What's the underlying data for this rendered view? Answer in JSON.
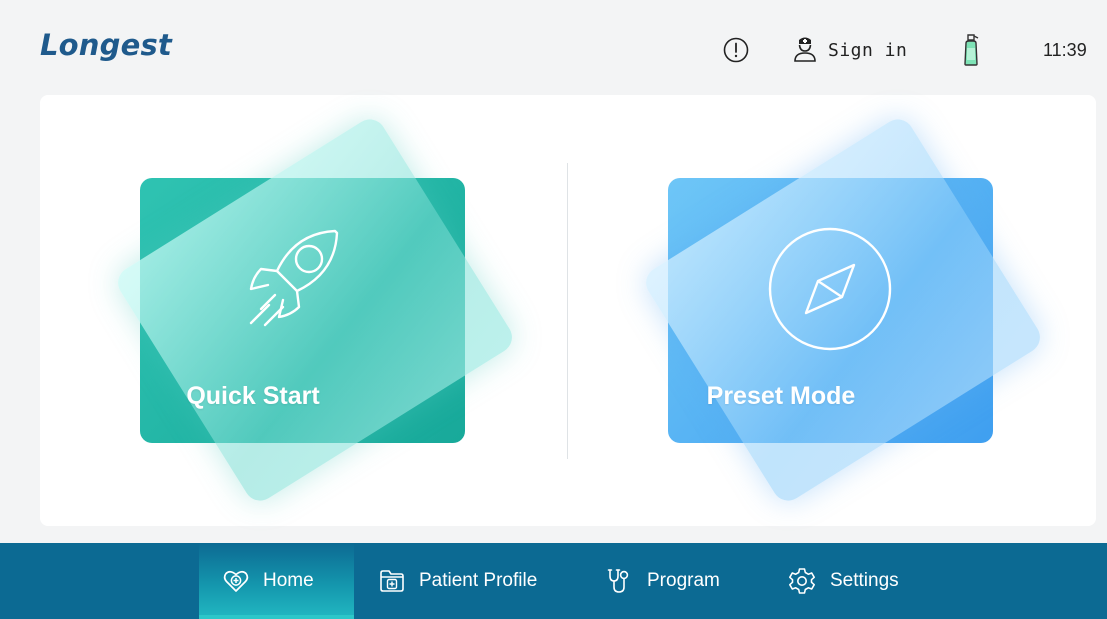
{
  "header": {
    "logo": "Longest",
    "alert_icon": "alert-circle-icon",
    "signin_label": "Sign in",
    "signin_icon": "nurse-icon",
    "disinfectant_icon": "spray-bottle-icon",
    "time": "11:39"
  },
  "main": {
    "cards": [
      {
        "label": "Quick Start",
        "icon": "rocket-icon",
        "color": "#1fb5a5"
      },
      {
        "label": "Preset Mode",
        "icon": "compass-icon",
        "color": "#4aa8f2"
      }
    ]
  },
  "nav": {
    "items": [
      {
        "label": "Home",
        "icon": "heart-medical-icon",
        "active": true
      },
      {
        "label": "Patient Profile",
        "icon": "medical-folder-icon",
        "active": false
      },
      {
        "label": "Program",
        "icon": "stethoscope-icon",
        "active": false
      },
      {
        "label": "Settings",
        "icon": "gear-icon",
        "active": false
      }
    ],
    "bg_color": "#0c6a93",
    "active_color": "#22b8c2"
  }
}
